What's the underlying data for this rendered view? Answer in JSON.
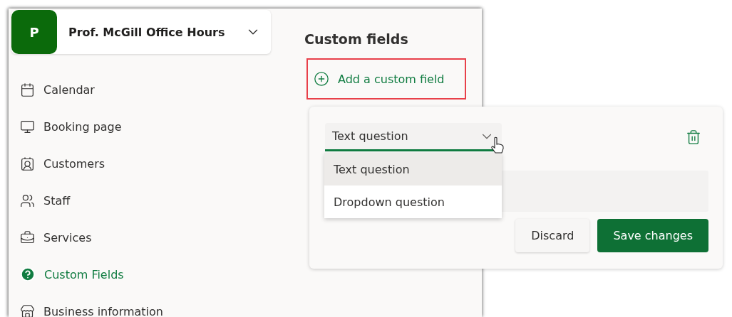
{
  "header": {
    "avatar": "P",
    "title": "Prof. McGill Office Hours"
  },
  "nav": [
    {
      "label": "Calendar",
      "selected": false
    },
    {
      "label": "Booking page",
      "selected": false
    },
    {
      "label": "Customers",
      "selected": false
    },
    {
      "label": "Staff",
      "selected": false
    },
    {
      "label": "Services",
      "selected": false
    },
    {
      "label": "Custom Fields",
      "selected": true
    },
    {
      "label": "Business information",
      "selected": false
    }
  ],
  "content": {
    "title": "Custom fields",
    "add_button": "Add a custom field"
  },
  "field_card": {
    "type_select": {
      "value": "Text question",
      "expanded": true
    },
    "options": [
      {
        "label": "Text question",
        "selected": true
      },
      {
        "label": "Dropdown question",
        "selected": false
      }
    ],
    "buttons": [
      {
        "label": "Discard",
        "kind": "secondary"
      },
      {
        "label": "Save changes",
        "kind": "primary"
      }
    ]
  }
}
